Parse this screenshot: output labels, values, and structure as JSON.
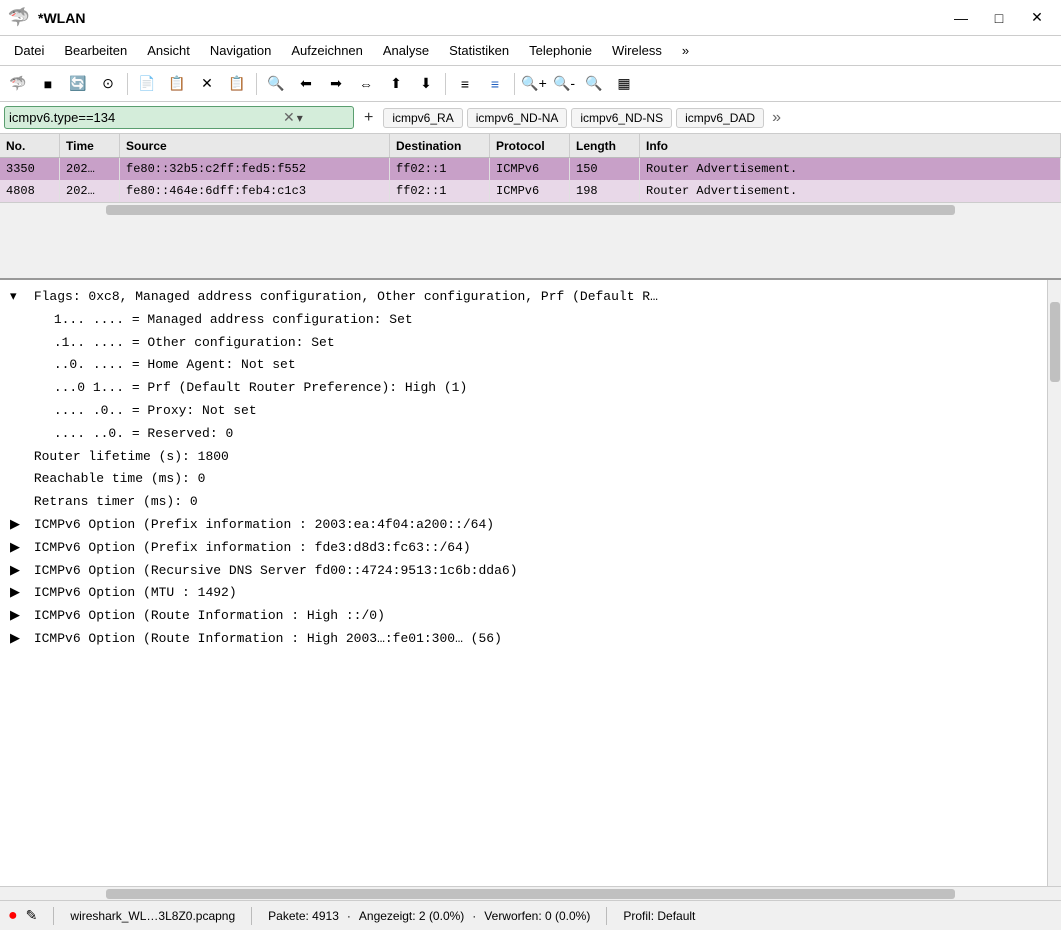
{
  "titlebar": {
    "title": "*WLAN",
    "logo": "🦈",
    "minimize_label": "—",
    "maximize_label": "□",
    "close_label": "✕"
  },
  "menubar": {
    "items": [
      "Datei",
      "Bearbeiten",
      "Ansicht",
      "Navigation",
      "Aufzeichnen",
      "Analyse",
      "Statistiken",
      "Telephonie",
      "Wireless",
      "»"
    ]
  },
  "toolbar": {
    "buttons": [
      "🦈",
      "■",
      "🔄",
      "⊙",
      "📄",
      "📋",
      "✕",
      "📋",
      "🔍",
      "⬅",
      "➡",
      "⇔",
      "⬆",
      "⬇",
      "≡",
      "≡",
      "🔍+",
      "🔍-",
      "🔍",
      "▦"
    ]
  },
  "filterbar": {
    "filter_value": "icmpv6.type==134",
    "tags": [
      "icmpv6_RA",
      "icmpv6_ND-NA",
      "icmpv6_ND-NS",
      "icmpv6_DAD"
    ],
    "plus_label": "+",
    "more_label": "»"
  },
  "packet_list": {
    "columns": [
      "No.",
      "Time",
      "Source",
      "Destination",
      "Protocol",
      "Length",
      "Info"
    ],
    "rows": [
      {
        "no": "3350",
        "time": "202…",
        "source": "fe80::32b5:c2ff:fed5:f552",
        "dest": "ff02::1",
        "proto": "ICMPv6",
        "len": "150",
        "info": "Router Advertisement.",
        "selected": true
      },
      {
        "no": "4808",
        "time": "202…",
        "source": "fe80::464e:6dff:feb4:c1c3",
        "dest": "ff02::1",
        "proto": "ICMPv6",
        "len": "198",
        "info": "Router Advertisement.",
        "selected": false
      }
    ]
  },
  "detail_pane": {
    "lines": [
      {
        "indent": 0,
        "expandable": true,
        "expanded": true,
        "text": "Flags: 0xc8, Managed address configuration, Other configuration, Prf (Default R…"
      },
      {
        "indent": 1,
        "expandable": false,
        "text": "1... .... = Managed address configuration: Set"
      },
      {
        "indent": 1,
        "expandable": false,
        "text": ".1.. .... = Other configuration: Set"
      },
      {
        "indent": 1,
        "expandable": false,
        "text": "..0. .... = Home Agent: Not set"
      },
      {
        "indent": 1,
        "expandable": false,
        "text": "...0 1... = Prf (Default Router Preference): High (1)"
      },
      {
        "indent": 1,
        "expandable": false,
        "text": ".... .0.. = Proxy: Not set"
      },
      {
        "indent": 1,
        "expandable": false,
        "text": ".... ..0. = Reserved: 0"
      },
      {
        "indent": 0,
        "expandable": false,
        "text": "Router lifetime (s): 1800"
      },
      {
        "indent": 0,
        "expandable": false,
        "text": "Reachable time (ms): 0"
      },
      {
        "indent": 0,
        "expandable": false,
        "text": "Retrans timer (ms): 0"
      },
      {
        "indent": 0,
        "expandable": true,
        "expanded": false,
        "text": "ICMPv6 Option (Prefix information : 2003:ea:4f04:a200::/64)"
      },
      {
        "indent": 0,
        "expandable": true,
        "expanded": false,
        "text": "ICMPv6 Option (Prefix information : fde3:d8d3:fc63::/64)"
      },
      {
        "indent": 0,
        "expandable": true,
        "expanded": false,
        "text": "ICMPv6 Option (Recursive DNS Server fd00::4724:9513:1c6b:dda6)"
      },
      {
        "indent": 0,
        "expandable": true,
        "expanded": false,
        "text": "ICMPv6 Option (MTU : 1492)"
      },
      {
        "indent": 0,
        "expandable": true,
        "expanded": false,
        "text": "ICMPv6 Option (Route Information : High ::/0)"
      },
      {
        "indent": 0,
        "expandable": true,
        "expanded": false,
        "text": "ICMPv6 Option (Route Information : High 2003…:fe01:300… (56)"
      }
    ]
  },
  "statusbar": {
    "filename": "wireshark_WL…3L8Z0.pcapng",
    "packets_label": "Pakete: 4913",
    "shown_label": "Angezeigt: 2 (0.0%)",
    "dropped_label": "Verworfen: 0 (0.0%)",
    "profile_label": "Profil: Default"
  }
}
